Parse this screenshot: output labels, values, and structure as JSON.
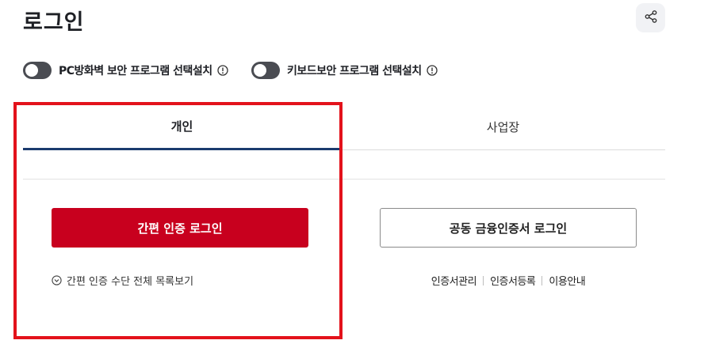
{
  "page": {
    "title": "로그인"
  },
  "toggles": [
    {
      "label": "PC방화벽 보안 프로그램 선택설치",
      "state": "off"
    },
    {
      "label": "키보드보안 프로그램 선택설치",
      "state": "off"
    }
  ],
  "tabs": [
    {
      "label": "개인",
      "active": true
    },
    {
      "label": "사업장",
      "active": false
    }
  ],
  "personal": {
    "simple_login_label": "간편 인증 로그인",
    "view_all_label": "간편 인증 수단 전체 목록보기"
  },
  "certificate": {
    "login_label": "공동 금융인증서 로그인",
    "links": [
      "인증서관리",
      "인증서등록",
      "이용안내"
    ]
  },
  "colors": {
    "brand_red": "#c8001e",
    "active_tab_underline": "#1b3b6e",
    "highlight": "#e3121b",
    "toggle_off": "#4a4c52"
  },
  "icons": [
    "share-icon",
    "info-icon",
    "chevron-down-circle-icon"
  ]
}
